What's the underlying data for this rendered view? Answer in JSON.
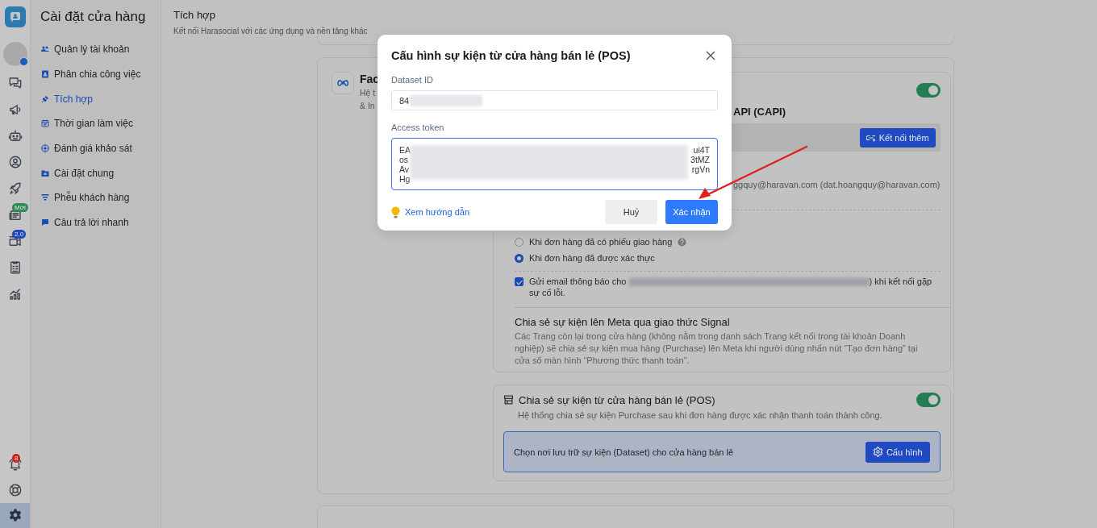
{
  "rail": {
    "top": [
      {
        "kind": "logo"
      },
      {
        "kind": "avatar"
      },
      {
        "kind": "chat",
        "selected": false
      },
      {
        "kind": "megaphone",
        "selected": false
      },
      {
        "kind": "bot",
        "selected": false
      },
      {
        "kind": "user",
        "selected": false
      },
      {
        "kind": "rocket",
        "selected": false
      },
      {
        "kind": "news",
        "selected": false,
        "badge": "Mới",
        "color": "#2e8a55"
      },
      {
        "kind": "video",
        "selected": false,
        "badge": "2.0",
        "color": "#1f48b8"
      },
      {
        "kind": "invoice",
        "selected": false
      },
      {
        "kind": "chart",
        "selected": false
      }
    ],
    "bottom": [
      {
        "kind": "bell",
        "selected": false,
        "badge": "8",
        "color": "#c8221b"
      },
      {
        "kind": "globe",
        "selected": false
      },
      {
        "kind": "gear",
        "selected": true
      }
    ]
  },
  "sidebar": {
    "title": "Cài đặt cửa hàng",
    "items": [
      {
        "kind": "users",
        "label": "Quản lý tài khoản",
        "selected": false
      },
      {
        "kind": "badge",
        "label": "Phân chia công việc",
        "selected": false
      },
      {
        "kind": "plug",
        "label": "Tích hợp",
        "selected": true
      },
      {
        "kind": "calendar",
        "label": "Thời gian làm việc",
        "selected": false
      },
      {
        "kind": "survey",
        "label": "Đánh giá khảo sát",
        "selected": false
      },
      {
        "kind": "folder",
        "label": "Cài đặt chung",
        "selected": false
      },
      {
        "kind": "funnel",
        "label": "Phễu khách hàng",
        "selected": false
      },
      {
        "kind": "message",
        "label": "Câu trả lời nhanh",
        "selected": false
      }
    ]
  },
  "main": {
    "title": "Tích hợp",
    "subtitle": "Kết nối Harasocial với các ứng dụng và nền tảng khác",
    "facebook": {
      "title": "Fac",
      "description": [
        "Hệ t",
        "& In"
      ],
      "capi": {
        "enabled": true,
        "title": "API (CAPI)",
        "connect_button": "Kết nối thêm",
        "account": "ggquy@haravan.com (dat.hoangquy@haravan.com)",
        "options": [
          {
            "label": "Khi đơn hàng đã có phiếu giao hàng",
            "help": true,
            "selected": false
          },
          {
            "label": "Khi đơn hàng đã được xác thực",
            "help": false,
            "selected": true
          }
        ],
        "email_notice": {
          "checked": true,
          "before": "Gửi email thông báo cho",
          "after": ") khi kết nối gặp sự cố lỗi."
        },
        "signal": {
          "title": "Chia sẻ sự kiện lên Meta qua giao thức Signal",
          "description": "Các Trang còn lại trong cửa hàng (không nằm trong danh sách Trang kết nối trong tài khoản Doanh nghiệp) sẽ chia sẻ sự kiện mua hàng (Purchase) lên Meta khi người dùng nhấn nút “Tạo đơn hàng” tại cửa sổ màn hình “Phương thức thanh toán”."
        }
      },
      "pos": {
        "enabled": true,
        "title": "Chia sẻ sự kiện từ cửa hàng bán lẻ (POS)",
        "description": "Hệ thống chia sẻ sự kiện Purchase sau khi đơn hàng được xác nhận thanh toán thành công.",
        "dataset_prompt": "Chọn nơi lưu trữ sự kiện (Dataset) cho cửa hàng bán lẻ",
        "configure_button": "Cấu hình"
      }
    }
  },
  "modal": {
    "title": "Cấu hình sự kiện từ cửa hàng bán lẻ (POS)",
    "dataset_label": "Dataset ID",
    "dataset_value": "84",
    "token_label": "Access token",
    "token_lines": [
      {
        "start": "EA",
        "end": "ui4T"
      },
      {
        "start": "os",
        "end": "3tMZ"
      },
      {
        "start": "Av",
        "end": "rgVn"
      },
      {
        "start": "Hg"
      }
    ],
    "guide_link": "Xem hướng dẫn",
    "cancel_button": "Huỷ",
    "confirm_button": "Xác nhận"
  }
}
